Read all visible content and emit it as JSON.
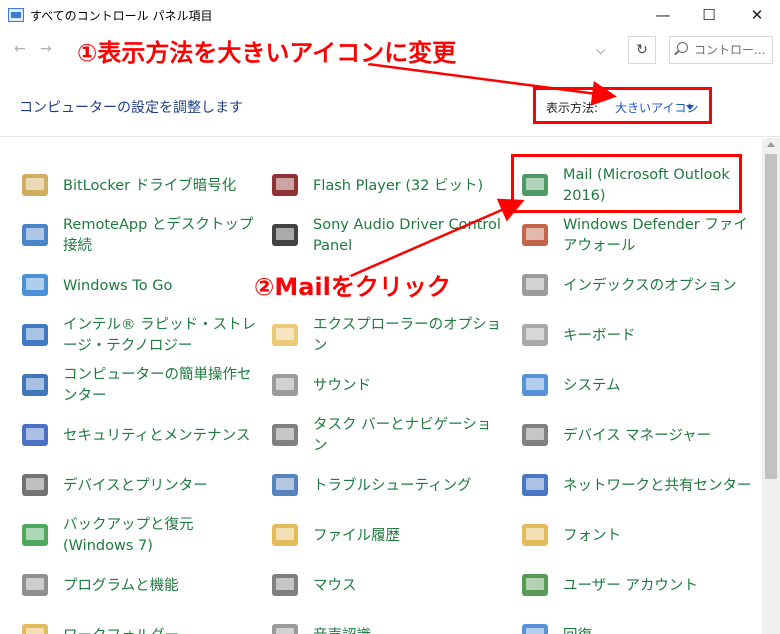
{
  "window": {
    "title": "すべてのコントロール パネル項目",
    "minimize": "—",
    "maximize": "☐",
    "close": "✕"
  },
  "address": {
    "back": "←",
    "forward": "→",
    "refresh": "↻",
    "search_placeholder": "コントロー..."
  },
  "header": {
    "title": "コンピューターの設定を調整します",
    "view_label": "表示方法:",
    "view_value": "大きいアイコン"
  },
  "annotations": {
    "step1": "①表示方法を大きいアイコンに変更",
    "step2": "②Mailをクリック"
  },
  "items": [
    {
      "label": "BitLocker ドライブ暗号化",
      "icon": "bitlocker-icon",
      "color": "#c8a040"
    },
    {
      "label": "Flash Player (32 ビット)",
      "icon": "flash-icon",
      "color": "#7a1111"
    },
    {
      "label": "Mail (Microsoft Outlook 2016)",
      "icon": "mail-icon",
      "color": "#2f8a4a"
    },
    {
      "label": "RemoteApp とデスクトップ接続",
      "icon": "remoteapp-icon",
      "color": "#2a6fc0"
    },
    {
      "label": "Sony Audio Driver Control Panel",
      "icon": "sony-audio-icon",
      "color": "#222222"
    },
    {
      "label": "Windows Defender ファイアウォール",
      "icon": "firewall-icon",
      "color": "#b84a2a"
    },
    {
      "label": "Windows To Go",
      "icon": "usb-drive-icon",
      "color": "#2a7fd0"
    },
    {
      "label": "",
      "icon": "blank",
      "color": "#ffffff"
    },
    {
      "label": "インデックスのオプション",
      "icon": "indexing-icon",
      "color": "#8a8a8a"
    },
    {
      "label": "インテル® ラピッド・ストレージ・テクノロジー",
      "icon": "intel-rst-icon",
      "color": "#1e63b8"
    },
    {
      "label": "エクスプローラーのオプション",
      "icon": "folder-options-icon",
      "color": "#e8c060"
    },
    {
      "label": "キーボード",
      "icon": "keyboard-icon",
      "color": "#9a9a9a"
    },
    {
      "label": "コンピューターの簡単操作センター",
      "icon": "ease-of-access-icon",
      "color": "#1f5fae"
    },
    {
      "label": "サウンド",
      "icon": "speaker-icon",
      "color": "#8a8a8a"
    },
    {
      "label": "システム",
      "icon": "system-icon",
      "color": "#3a7fd0"
    },
    {
      "label": "セキュリティとメンテナンス",
      "icon": "security-flag-icon",
      "color": "#2a58b8"
    },
    {
      "label": "タスク バーとナビゲーション",
      "icon": "taskbar-icon",
      "color": "#6a6a6a"
    },
    {
      "label": "デバイス マネージャー",
      "icon": "device-manager-icon",
      "color": "#6a6a6a"
    },
    {
      "label": "デバイスとプリンター",
      "icon": "printer-icon",
      "color": "#5a5a5a"
    },
    {
      "label": "トラブルシューティング",
      "icon": "troubleshoot-icon",
      "color": "#3a6fb0"
    },
    {
      "label": "ネットワークと共有センター",
      "icon": "network-icon",
      "color": "#2a5fb8"
    },
    {
      "label": "バックアップと復元 (Windows 7)",
      "icon": "backup-icon",
      "color": "#2e9a3e"
    },
    {
      "label": "ファイル履歴",
      "icon": "file-history-icon",
      "color": "#e0b040"
    },
    {
      "label": "フォント",
      "icon": "fonts-icon",
      "color": "#e0b040"
    },
    {
      "label": "プログラムと機能",
      "icon": "programs-icon",
      "color": "#7a7a7a"
    },
    {
      "label": "マウス",
      "icon": "mouse-icon",
      "color": "#6a6a6a"
    },
    {
      "label": "ユーザー アカウント",
      "icon": "user-accounts-icon",
      "color": "#3a8a3a"
    },
    {
      "label": "ワークフォルダー",
      "icon": "work-folders-icon",
      "color": "#e0b040"
    },
    {
      "label": "音声認識",
      "icon": "microphone-icon",
      "color": "#8a8a8a"
    },
    {
      "label": "回復",
      "icon": "recovery-icon",
      "color": "#3a7fd0"
    }
  ]
}
